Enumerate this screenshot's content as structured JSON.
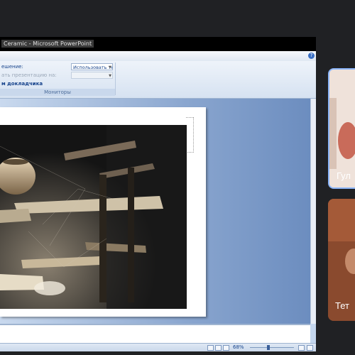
{
  "window": {
    "title": "Ceramic - Microsoft PowerPoint"
  },
  "ribbon": {
    "help_label": "?",
    "resolution_label": "ешение:",
    "resolution_value": "Использовать текуще...",
    "show_on_label": "ать презентацию на:",
    "show_on_value": "",
    "presenter_view_label": "м докладчика",
    "group_label": "Мониторы"
  },
  "statusbar": {
    "zoom": "68%"
  },
  "participants": [
    {
      "name": "Гул"
    },
    {
      "name": "Тет"
    }
  ]
}
